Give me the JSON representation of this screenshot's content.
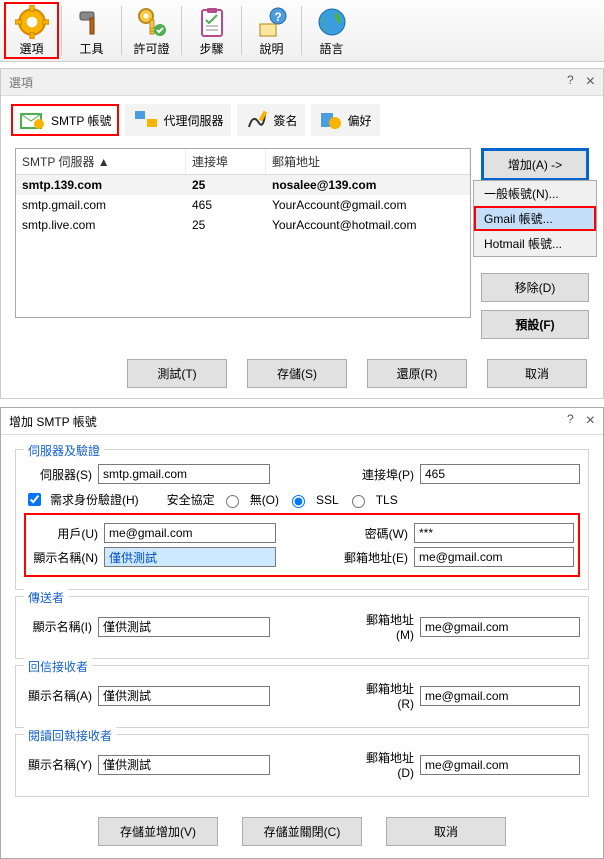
{
  "toolbar": {
    "items": [
      {
        "label": "選項"
      },
      {
        "label": "工具"
      },
      {
        "label": "許可證"
      },
      {
        "label": "步驟"
      },
      {
        "label": "說明"
      },
      {
        "label": "語言"
      }
    ]
  },
  "options": {
    "title": "選項",
    "help_glyph": "?",
    "close_glyph": "×",
    "tabs": [
      {
        "label": "SMTP 帳號"
      },
      {
        "label": "代理伺服器"
      },
      {
        "label": "簽名"
      },
      {
        "label": "偏好"
      }
    ],
    "table": {
      "headers": [
        "SMTP 伺服器 ▲",
        "連接埠",
        "郵箱地址"
      ],
      "rows": [
        {
          "server": "smtp.139.com",
          "port": "25",
          "email": "nosalee@139.com",
          "bold": true
        },
        {
          "server": "smtp.gmail.com",
          "port": "465",
          "email": "YourAccount@gmail.com"
        },
        {
          "server": "smtp.live.com",
          "port": "25",
          "email": "YourAccount@hotmail.com"
        }
      ]
    },
    "side": {
      "add": "增加(A) ->",
      "menu": [
        {
          "label": "一般帳號(N)..."
        },
        {
          "label": "Gmail 帳號..."
        },
        {
          "label": "Hotmail 帳號..."
        }
      ],
      "remove": "移除(D)",
      "default": "預設(F)"
    },
    "footer": {
      "test": "測試(T)",
      "save": "存儲(S)",
      "restore": "還原(R)",
      "cancel": "取消"
    }
  },
  "smtp": {
    "title": "增加 SMTP 帳號",
    "help_glyph": "?",
    "close_glyph": "×",
    "legend_server": "伺服器及驗證",
    "lbl_server": "伺服器(S)",
    "val_server": "smtp.gmail.com",
    "lbl_port": "連接埠(P)",
    "val_port": "465",
    "chk_auth": "需求身份驗證(H)",
    "lbl_security": "安全協定",
    "radio_none": "無(O)",
    "radio_ssl": "SSL",
    "radio_tls": "TLS",
    "lbl_user": "用戶(U)",
    "val_user": "me@gmail.com",
    "lbl_pass": "密碼(W)",
    "val_pass": "***",
    "lbl_display": "顯示名稱(N)",
    "val_display": "僅供測試",
    "lbl_email": "郵箱地址(E)",
    "val_email": "me@gmail.com",
    "legend_sender": "傳送者",
    "lbl_display_i": "顯示名稱(I)",
    "lbl_email_m": "郵箱地址(M)",
    "legend_reply": "回信接收者",
    "lbl_display_a": "顯示名稱(A)",
    "lbl_email_r": "郵箱地址(R)",
    "legend_receipt": "閱讀回執接收者",
    "lbl_display_y": "顯示名稱(Y)",
    "lbl_email_d": "郵箱地址(D)",
    "footer": {
      "save_add": "存儲並增加(V)",
      "save_close": "存儲並關閉(C)",
      "cancel": "取消"
    }
  }
}
